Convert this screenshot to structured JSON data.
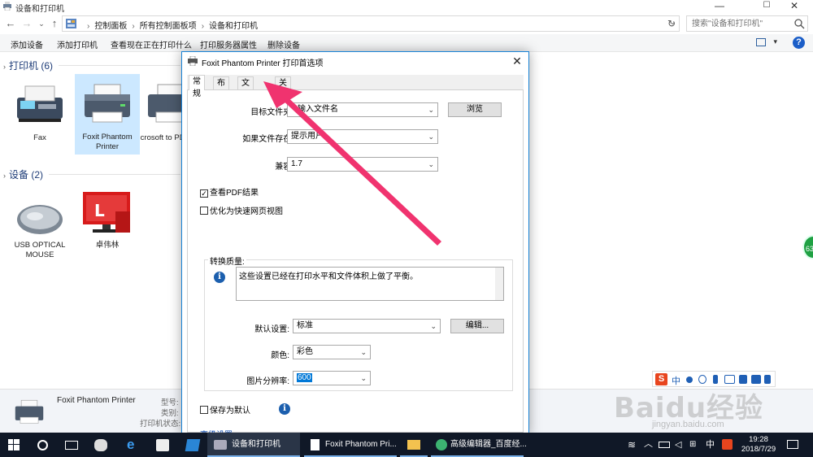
{
  "window": {
    "title": "设备和打印机",
    "controls": {
      "minimize": "—",
      "maximize": "☐",
      "close": "✕"
    }
  },
  "address": {
    "crumbs": [
      "控制面板",
      "所有控制面板项",
      "设备和打印机"
    ],
    "search_placeholder": "搜索\"设备和打印机\""
  },
  "toolbar": {
    "commands": [
      "添加设备",
      "添加打印机",
      "查看现在正在打印什么",
      "打印服务器属性",
      "删除设备"
    ],
    "help": "?"
  },
  "groups": {
    "printers": {
      "header": "打印机 (6)",
      "items": [
        {
          "label": "Fax"
        },
        {
          "label": "Foxit Phantom Printer",
          "selected": true
        },
        {
          "label": "Microsoft to PDF"
        }
      ]
    },
    "devices": {
      "header": "设备 (2)",
      "items": [
        {
          "label": "USB OPTICAL MOUSE"
        },
        {
          "label": "卓伟林"
        }
      ]
    }
  },
  "details": {
    "name": "Foxit Phantom Printer",
    "keys": [
      "型号:",
      "类别:",
      "打印机状态:"
    ]
  },
  "dialog": {
    "title": "Foxit Phantom Printer 打印首选项",
    "close": "✕",
    "tabs": [
      "常规",
      "布局",
      "文档信息",
      "关于"
    ],
    "active_tab": "常规",
    "fields": {
      "target_folder": {
        "label": "目标文件夹:",
        "value": "输入文件名"
      },
      "browse": "浏览",
      "if_exists": {
        "label": "如果文件存在:",
        "value": "提示用户"
      },
      "compat": {
        "label": "兼容:",
        "value": "1.7"
      },
      "view_pdf": {
        "label": "查看PDF结果",
        "checked": true
      },
      "optimize_web": {
        "label": "优化为快速网页视图",
        "checked": false
      },
      "quality": {
        "legend": "转换质量:",
        "description": "这些设置已经在打印水平和文件体积上做了平衡。",
        "default_label": "默认设置:",
        "default_value": "标准",
        "edit": "编辑...",
        "color_label": "颜色:",
        "color_value": "彩色",
        "dpi_label": "图片分辨率:",
        "dpi_value": "600"
      },
      "save_default": {
        "label": "保存为默认",
        "checked": false
      },
      "advanced": "高级设置..."
    }
  },
  "overlay": {
    "badge": "63",
    "ime": {
      "logo": "S",
      "lang": "中"
    },
    "watermark": "Baidu经验",
    "watermark_url": "jingyan.baidu.com",
    "arrow_color": "#f0336f"
  },
  "taskbar": {
    "apps": [
      {
        "label": "设备和打印机"
      },
      {
        "label": "Foxit Phantom Pri..."
      },
      {
        "label": ""
      },
      {
        "label": "高级编辑器_百度经..."
      }
    ],
    "tray": {
      "ime": "中",
      "time": "19:28",
      "date": "2018/7/29"
    }
  }
}
